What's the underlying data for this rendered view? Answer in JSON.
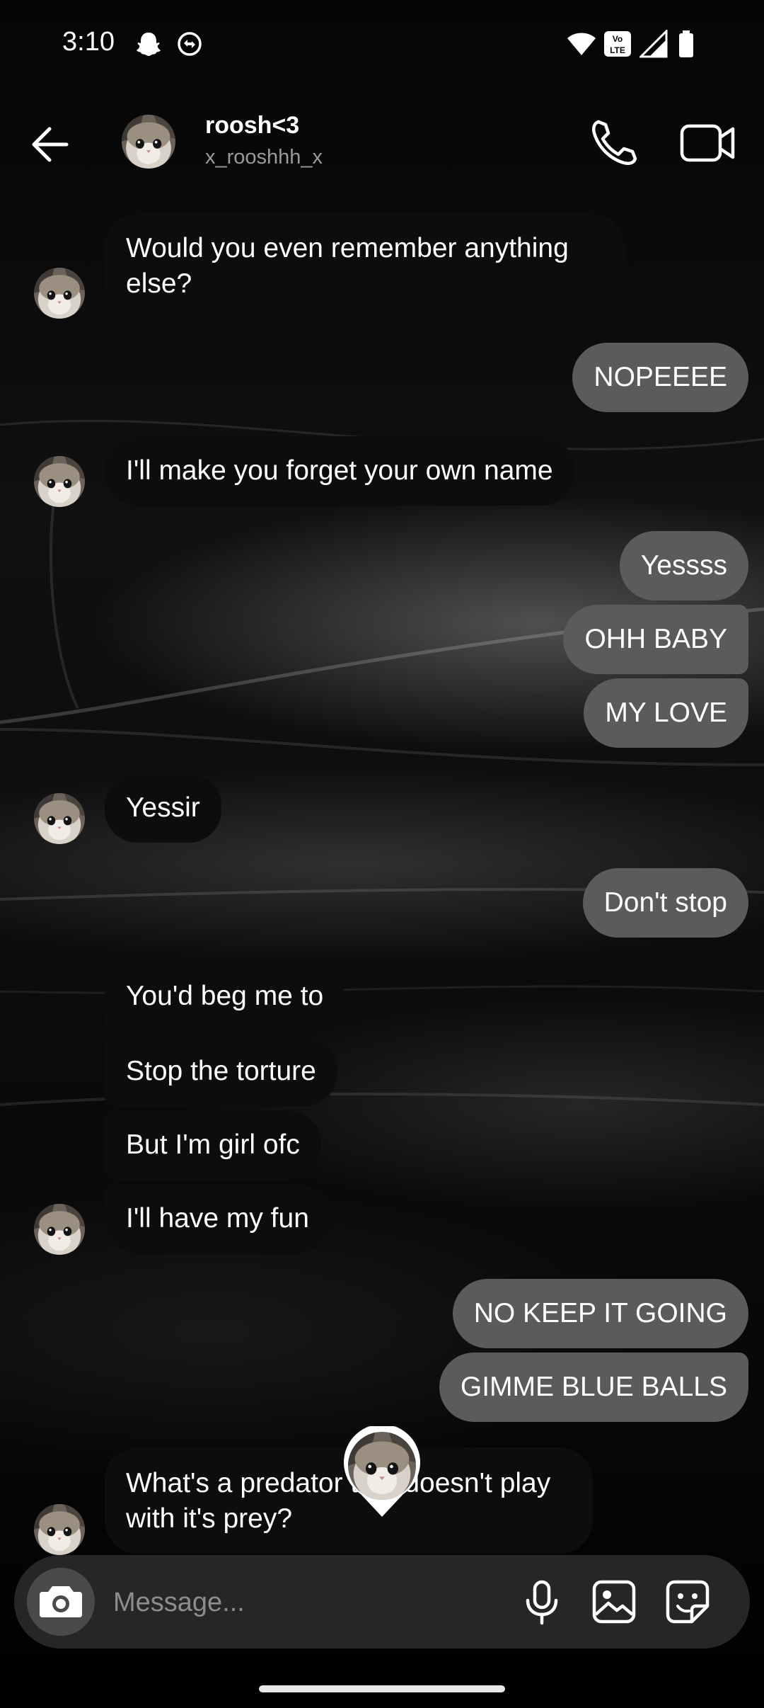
{
  "status_bar": {
    "time": "3:10",
    "icons": [
      "snapchat-icon",
      "sync-icon",
      "wifi-icon",
      "volte-icon",
      "signal-icon",
      "battery-icon"
    ]
  },
  "header": {
    "name": "roosh<3",
    "username": "x_rooshhh_x",
    "icons": [
      "back-arrow-icon",
      "avatar",
      "phone-icon",
      "video-camera-icon"
    ]
  },
  "messages": [
    {
      "side": "in",
      "text": "Would you even remember anything else?"
    },
    {
      "side": "out",
      "text": "NOPEEEE"
    },
    {
      "side": "in",
      "text": "I'll make you forget your own name"
    },
    {
      "side": "out",
      "text": "Yessss"
    },
    {
      "side": "out",
      "text": "OHH BABY"
    },
    {
      "side": "out",
      "text": "MY LOVE"
    },
    {
      "side": "in",
      "text": "Yessir"
    },
    {
      "side": "out",
      "text": "Don't stop"
    },
    {
      "side": "in",
      "text": "You'd beg me to"
    },
    {
      "side": "in",
      "text": "Stop the torture"
    },
    {
      "side": "in",
      "text": "But I'm girl ofc"
    },
    {
      "side": "in",
      "text": "I'll have my fun"
    },
    {
      "side": "out",
      "text": "NO KEEP IT GOING"
    },
    {
      "side": "out",
      "text": "GIMME BLUE BALLS"
    },
    {
      "side": "in",
      "text": "What's a predator that doesn't play with it's prey?"
    }
  ],
  "composer": {
    "placeholder": "Message...",
    "icons": [
      "camera-icon",
      "microphone-icon",
      "gallery-icon",
      "sticker-icon"
    ]
  },
  "colors": {
    "incoming_bubble": "#0d0d0d",
    "outgoing_bubble": "#5b5b5b",
    "composer_bg": "#262626",
    "username": "#9a9a9a"
  }
}
